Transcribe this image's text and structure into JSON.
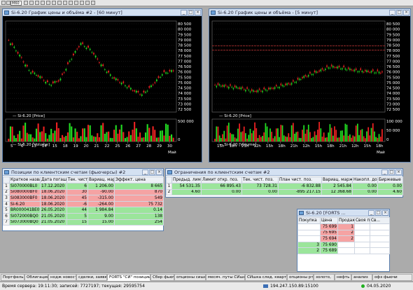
{
  "toolbar": {
    "combo_value": "М60"
  },
  "chart_left": {
    "title": "Si-6.20 График цены и объёма #2 - [60 минут]",
    "price_label": "Si-6.20 [Price]",
    "volume_label": "Si-6.20 [Volume]",
    "month_label": "Май",
    "y_ticks": [
      "80 500",
      "80 000",
      "79 500",
      "79 000",
      "78 500",
      "78 000",
      "77 500",
      "77 000",
      "76 500",
      "76 000",
      "75 500",
      "75 000",
      "74 500",
      "74 000",
      "73 500",
      "73 000",
      "72 500"
    ],
    "x_ticks": [
      "5",
      "6",
      "13",
      "14",
      "15",
      "18",
      "19",
      "20",
      "21",
      "22",
      "25",
      "26",
      "27",
      "28",
      "29",
      "30"
    ],
    "vol_ticks": [
      "500 000",
      "0"
    ]
  },
  "chart_right": {
    "title": "Si-6.20 График цены и объёма - [5 минут]",
    "price_label": "Si-6.20 [Price]",
    "volume_label": "Si-6.20 [Volume]",
    "month_label": "Май",
    "y_ticks": [
      "80 500",
      "80 000",
      "79 500",
      "79 000",
      "78 500",
      "78 000",
      "77 500",
      "77 000",
      "76 500",
      "76 000",
      "75 500",
      "75 000",
      "74 500",
      "74 000",
      "73 500",
      "73 000",
      "72 500"
    ],
    "x_ticks": [
      "15h",
      "18h",
      "21h",
      "12h",
      "15h",
      "18h",
      "21h",
      "12h",
      "15h",
      "18h",
      "21h",
      "12h",
      "15h",
      "18h"
    ],
    "vol_ticks": [
      "100 000",
      "50 000",
      "0"
    ]
  },
  "positions": {
    "title": "Позиции по клиентским счетам (фьючерсы) #2",
    "headers": [
      "Краткое название",
      "Дата погашения",
      "Тек. чист. поз.",
      "Вариац. маржа",
      "Эффект. цена"
    ],
    "rows": [
      {
        "n": "1",
        "name": "Si070000BL0",
        "date": "17.12.2020",
        "pos": "6",
        "var": "1 206.00",
        "eff": "8 665"
      },
      {
        "n": "2",
        "name": "Si080000BF0",
        "date": "18.06.2020",
        "pos": "30",
        "var": "-90.00",
        "eff": "870"
      },
      {
        "n": "3",
        "name": "Si083000BF0",
        "date": "18.06.2020",
        "pos": "45",
        "var": "-315.00",
        "eff": "549"
      },
      {
        "n": "4",
        "name": "Si-6.20",
        "date": "18.06.2020",
        "pos": "-6",
        "var": "-264.00",
        "eff": "75 732"
      },
      {
        "n": "5",
        "name": "BR000041BE0",
        "date": "26.05.2020",
        "pos": "44",
        "var": "1 984.84",
        "eff": "0.14"
      },
      {
        "n": "6",
        "name": "Si072000BQ0",
        "date": "21.05.2020",
        "pos": "5",
        "var": "9.00",
        "eff": "138"
      },
      {
        "n": "7",
        "name": "Si073000BQ0",
        "date": "21.05.2020",
        "pos": "15",
        "var": "15.00",
        "eff": "254"
      }
    ]
  },
  "limits": {
    "title": "Ограничения по клиентским счетам #2",
    "headers": [
      "Предыд. лимит",
      "Лимит откр. поз.",
      "Тек. чист. поз.",
      "План чист. поз.",
      "Вариац. маржа",
      "Накопл. доход",
      "Биржевые сборы"
    ],
    "rows": [
      {
        "n": "1",
        "a": "54 531.35",
        "b": "66 895.43",
        "c": "73 728.31",
        "d": "-6 832.88",
        "e": "2 545.84",
        "f": "0.00",
        "g": "0.00"
      },
      {
        "n": "2",
        "a": "4.60",
        "b": "0.00",
        "c": "0.00",
        "d": "-895 217.15",
        "e": "12 368.68",
        "f": "0.00",
        "g": "4.60"
      }
    ]
  },
  "orderbook": {
    "title": "Si-6.20 [FORTS ...",
    "headers": [
      "Покупка",
      "Цена",
      "Продажа",
      "Своя по...",
      "Св..."
    ],
    "rows": [
      {
        "buy": "",
        "price": "75 699",
        "sell": "1"
      },
      {
        "buy": "",
        "price": "75 695",
        "sell": "2"
      },
      {
        "buy": "",
        "price": "75 694",
        "sell": "2"
      },
      {
        "buy": "3",
        "price": "75 690",
        "sell": ""
      },
      {
        "buy": "2",
        "price": "75 689",
        "sell": ""
      }
    ]
  },
  "tabs": [
    "Портфель",
    "Облигации",
    "нодж новости",
    "сделки, заявки",
    "FORTS \"СИ\" позиции...",
    "Сбер фьюч",
    "опционы сишка",
    "месяч. путы СИшка",
    "СИшка след. квартал",
    "опционы ртс",
    "золото,",
    "нефть",
    "анализ",
    "офз фьючи"
  ],
  "status": {
    "server_time": "Время сервера: 19:11:30; записей: 7727197; текущая: 29595754",
    "ip": "194.247.150.89:15100",
    "date": "04.05.2020"
  },
  "colors": {
    "up_candle": "#22dd22",
    "down_candle": "#ee2222",
    "row_green": "#9be59b",
    "row_red": "#f5a3a3"
  }
}
